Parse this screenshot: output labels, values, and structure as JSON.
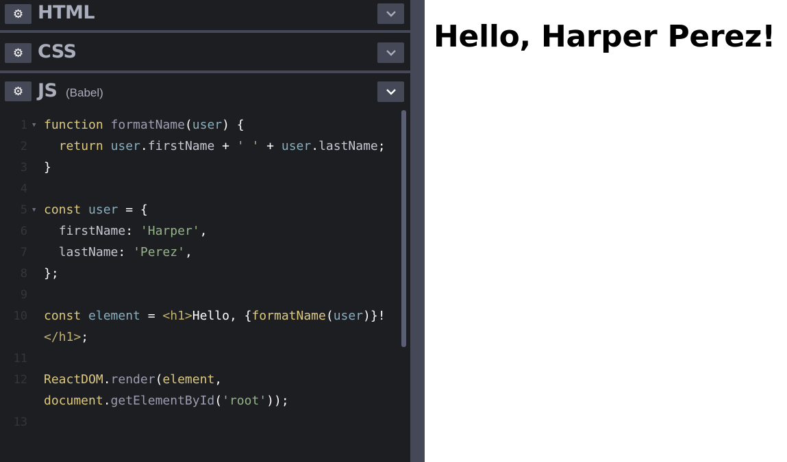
{
  "panels": [
    {
      "title": "HTML",
      "subtitle": ""
    },
    {
      "title": "CSS",
      "subtitle": ""
    },
    {
      "title": "JS",
      "subtitle": "(Babel)"
    }
  ],
  "icons": {
    "settings": "gear-icon",
    "collapse": "chevron-down-icon"
  },
  "code": {
    "line_numbers": [
      "1",
      "2",
      "3",
      "4",
      "5",
      "6",
      "7",
      "8",
      "9",
      "10",
      "11",
      "12",
      "13"
    ],
    "lines": [
      {
        "parts": [
          [
            "k",
            "function"
          ],
          [
            "o",
            " "
          ],
          [
            "f",
            "formatName"
          ],
          [
            "p",
            "("
          ],
          [
            "v",
            "user"
          ],
          [
            "p",
            ") {"
          ]
        ]
      },
      {
        "parts": [
          [
            "o",
            "  "
          ],
          [
            "k",
            "return"
          ],
          [
            "o",
            " "
          ],
          [
            "v",
            "user"
          ],
          [
            "p",
            "."
          ],
          [
            "prop",
            "firstName"
          ],
          [
            "o",
            " + "
          ],
          [
            "s",
            "' '"
          ],
          [
            "o",
            " + "
          ],
          [
            "v",
            "user"
          ],
          [
            "p",
            "."
          ],
          [
            "prop",
            "lastName"
          ],
          [
            "p",
            ";"
          ]
        ]
      },
      {
        "parts": [
          [
            "p",
            "}"
          ]
        ]
      },
      {
        "parts": []
      },
      {
        "parts": [
          [
            "k",
            "const"
          ],
          [
            "o",
            " "
          ],
          [
            "v",
            "user"
          ],
          [
            "o",
            " = "
          ],
          [
            "p",
            "{"
          ]
        ]
      },
      {
        "parts": [
          [
            "o",
            "  "
          ],
          [
            "prop",
            "firstName"
          ],
          [
            "p",
            ": "
          ],
          [
            "s",
            "'Harper'"
          ],
          [
            "p",
            ","
          ]
        ]
      },
      {
        "parts": [
          [
            "o",
            "  "
          ],
          [
            "prop",
            "lastName"
          ],
          [
            "p",
            ": "
          ],
          [
            "s",
            "'Perez'"
          ],
          [
            "p",
            ","
          ]
        ]
      },
      {
        "parts": [
          [
            "p",
            "};"
          ]
        ]
      },
      {
        "parts": []
      },
      {
        "parts": [
          [
            "k",
            "const"
          ],
          [
            "o",
            " "
          ],
          [
            "v",
            "element"
          ],
          [
            "o",
            " = "
          ],
          [
            "tag",
            "<h1>"
          ],
          [
            "txt",
            "Hello, "
          ],
          [
            "p",
            "{"
          ],
          [
            "jsx",
            "formatName"
          ],
          [
            "p",
            "("
          ],
          [
            "v",
            "user"
          ],
          [
            "p",
            ")}"
          ],
          [
            "txt",
            "!"
          ]
        ]
      },
      {
        "parts": [
          [
            "tag",
            "</h1>"
          ],
          [
            "p",
            ";"
          ]
        ]
      },
      {
        "parts": []
      },
      {
        "parts": [
          [
            "jsx",
            "ReactDOM"
          ],
          [
            "p",
            "."
          ],
          [
            "f",
            "render"
          ],
          [
            "p",
            "("
          ],
          [
            "jsx",
            "element"
          ],
          [
            "p",
            ","
          ]
        ]
      },
      {
        "parts": [
          [
            "jsx",
            "document"
          ],
          [
            "p",
            "."
          ],
          [
            "f",
            "getElementById"
          ],
          [
            "p",
            "("
          ],
          [
            "s",
            "'root'"
          ],
          [
            "p",
            "));"
          ]
        ]
      },
      {
        "parts": []
      }
    ]
  },
  "preview": {
    "heading": "Hello, Harper Perez!"
  },
  "colors": {
    "editor_bg": "#1d1e22",
    "button_bg": "#444857",
    "keyword": "#ddca7e",
    "variable": "#88afbf",
    "string": "#96b38a"
  }
}
